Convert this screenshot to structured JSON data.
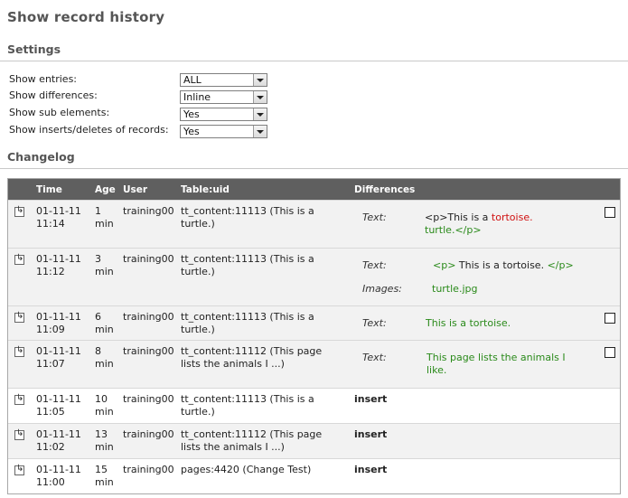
{
  "page": {
    "title": "Show record history"
  },
  "settings": {
    "heading": "Settings",
    "items": [
      {
        "label": "Show entries:",
        "value": "ALL"
      },
      {
        "label": "Show differences:",
        "value": "Inline"
      },
      {
        "label": "Show sub elements:",
        "value": "Yes"
      },
      {
        "label": "Show inserts/deletes of records:",
        "value": "Yes"
      }
    ]
  },
  "changelog": {
    "heading": "Changelog",
    "columns": {
      "time": "Time",
      "age": "Age",
      "user": "User",
      "table_uid": "Table:uid",
      "differences": "Differences"
    },
    "rows": [
      {
        "time": [
          "01-11-11",
          "11:14"
        ],
        "age": [
          "1",
          "min"
        ],
        "user": "training00",
        "table_uid": [
          "tt_content:11113 (This is a",
          "turtle.)"
        ],
        "diffs": [
          {
            "key": "Text:",
            "pre": "<p>This is a ",
            "del": "tortoise.",
            "line2": "turtle.</p>"
          }
        ]
      },
      {
        "time": [
          "01-11-11",
          "11:12"
        ],
        "age": [
          "3",
          "min"
        ],
        "user": "training00",
        "table_uid": [
          "tt_content:11113 (This is a",
          "turtle.)"
        ],
        "diffs": [
          {
            "key": "Text:",
            "a": "<p>",
            "b": " This is a tortoise. ",
            "c": "</p>"
          },
          {
            "key": "Images:",
            "val": "turtle.jpg"
          }
        ]
      },
      {
        "time": [
          "01-11-11",
          "11:09"
        ],
        "age": [
          "6",
          "min"
        ],
        "user": "training00",
        "table_uid": [
          "tt_content:11113 (This is a",
          "turtle.)"
        ],
        "diffs": [
          {
            "key": "Text:",
            "val": "This is a tortoise."
          }
        ]
      },
      {
        "time": [
          "01-11-11",
          "11:07"
        ],
        "age": [
          "8",
          "min"
        ],
        "user": "training00",
        "table_uid": [
          "tt_content:11112 (This page",
          "lists the animals I ...)"
        ],
        "diffs": [
          {
            "key": "Text:",
            "val": [
              "This page lists the animals I",
              "like."
            ]
          }
        ]
      },
      {
        "time": [
          "01-11-11",
          "11:05"
        ],
        "age": [
          "10",
          "min"
        ],
        "user": "training00",
        "table_uid": [
          "tt_content:11113 (This is a",
          "turtle.)"
        ],
        "action": "insert"
      },
      {
        "time": [
          "01-11-11",
          "11:02"
        ],
        "age": [
          "13",
          "min"
        ],
        "user": "training00",
        "table_uid": [
          "tt_content:11112 (This page",
          "lists the animals I ...)"
        ],
        "action": "insert"
      },
      {
        "time": [
          "01-11-11",
          "11:00"
        ],
        "age": [
          "15",
          "min"
        ],
        "user": "training00",
        "table_uid": [
          "pages:4420 (Change Test)"
        ],
        "action": "insert"
      }
    ]
  }
}
